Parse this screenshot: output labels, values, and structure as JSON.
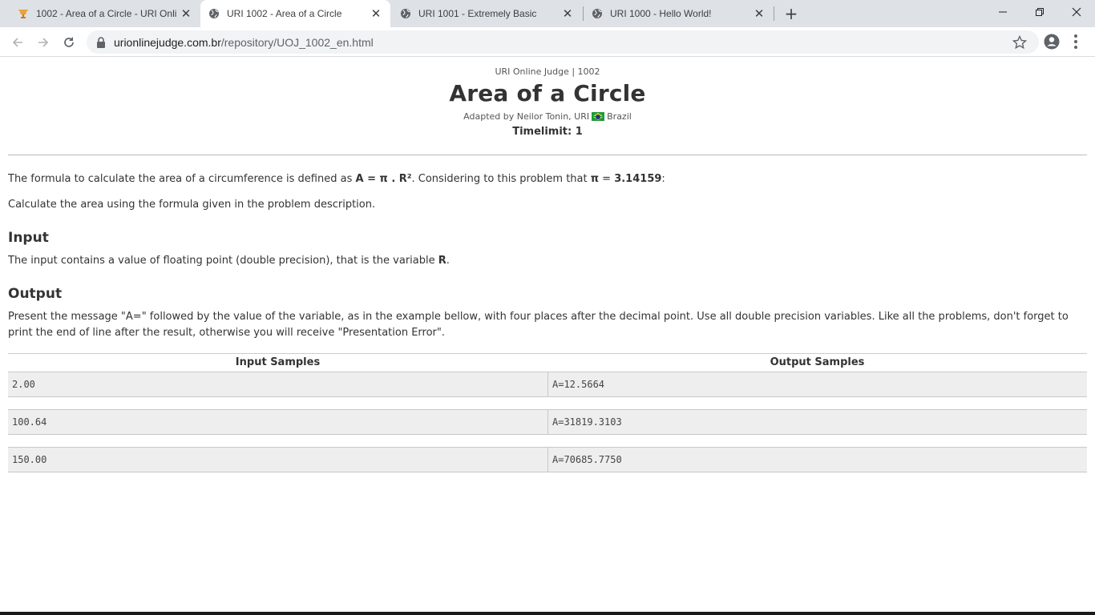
{
  "browser": {
    "tabs": [
      {
        "title": "1002 - Area of a Circle - URI Onli",
        "icon": "uri-trophy-icon"
      },
      {
        "title": "URI 1002 - Area of a Circle",
        "icon": "globe-icon"
      },
      {
        "title": "URI 1001 - Extremely Basic",
        "icon": "globe-icon"
      },
      {
        "title": "URI 1000 - Hello World!",
        "icon": "globe-icon"
      }
    ],
    "url_host": "urionlinejudge.com.br",
    "url_path": "/repository/UOJ_1002_en.html"
  },
  "problem": {
    "source": "URI Online Judge | 1002",
    "title": "Area of a Circle",
    "adapted_by": "Adapted by Neilor Tonin, URI",
    "country": "Brazil",
    "timelimit": "Timelimit: 1",
    "desc_part1": "The formula to calculate the area of a circumference is defined as ",
    "formula": "A = π . R²",
    "desc_part2": ". Considering to this problem that ",
    "pi_label": "π",
    "desc_part3": " = ",
    "pi_value": "3.14159",
    "desc_part4": ":",
    "desc_line2": "Calculate the area using the formula given in the problem description.",
    "input_heading": "Input",
    "input_text": "The input contains a value of floating point (double precision), that is the variable ",
    "input_var": "R",
    "input_end": ".",
    "output_heading": "Output",
    "output_text": "Present the message \"A=\" followed by the value of the variable, as in the example bellow, with four places after the decimal point. Use all double precision variables. Like all the problems, don't forget to print the end of line after the result, otherwise you will receive \"Presentation Error\".",
    "samples_input_header": "Input Samples",
    "samples_output_header": "Output Samples",
    "samples": [
      {
        "input": "2.00",
        "output": "A=12.5664"
      },
      {
        "input": "100.64",
        "output": "A=31819.3103"
      },
      {
        "input": "150.00",
        "output": "A=70685.7750"
      }
    ]
  }
}
